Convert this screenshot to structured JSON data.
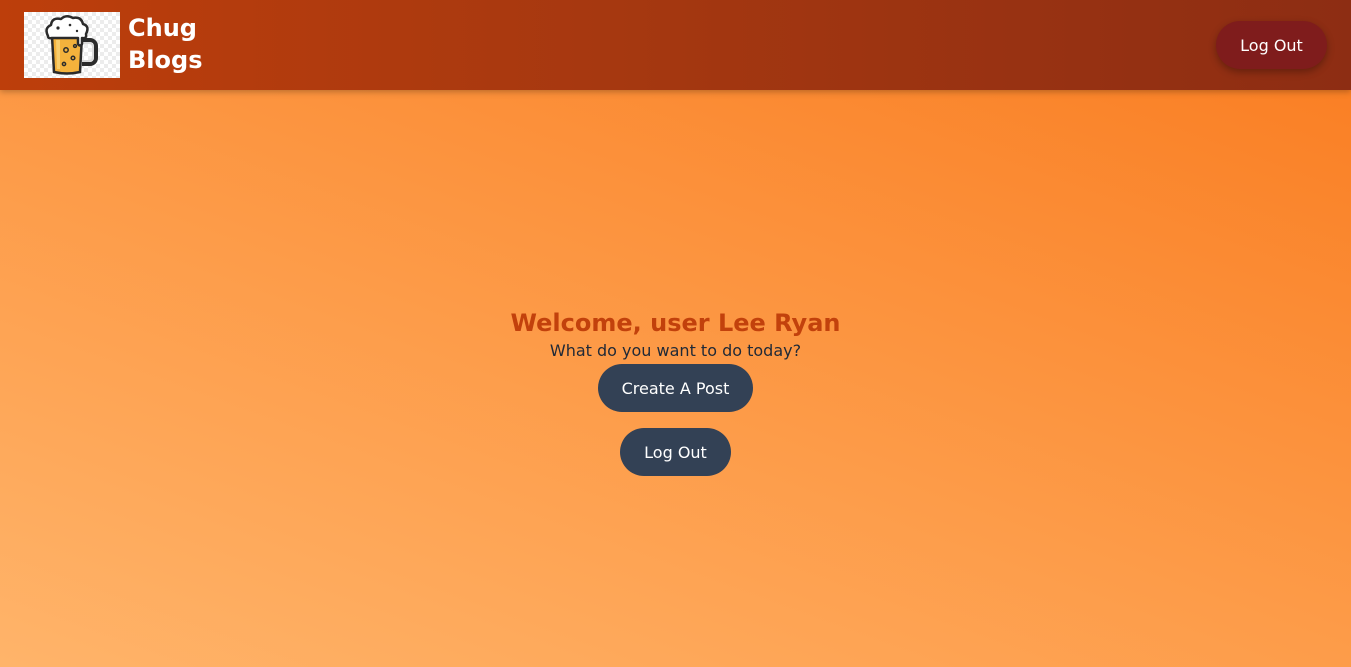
{
  "header": {
    "brand_line1": "Chug",
    "brand_line2": "Blogs",
    "logout_label": "Log Out",
    "logo_icon": "beer-mug-icon"
  },
  "main": {
    "welcome_heading": "Welcome, user Lee Ryan",
    "subtitle": "What do you want to do today?",
    "create_post_label": "Create A Post",
    "logout_label": "Log Out"
  },
  "colors": {
    "header_bg": "#a63810",
    "header_logout_bg": "#7f1c1c",
    "heading_text": "#c2410c",
    "button_bg": "#334155",
    "page_gradient_start": "#ffb46a",
    "page_gradient_end": "#f97b1f"
  }
}
